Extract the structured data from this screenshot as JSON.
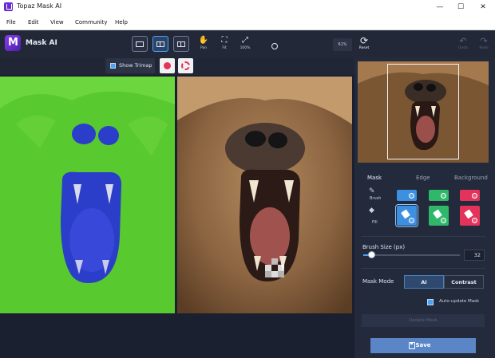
{
  "window": {
    "title": "Topaz Mask AI",
    "minimize": "—",
    "maximize": "☐",
    "close": "✕"
  },
  "menu": [
    "File",
    "Edit",
    "View",
    "Community",
    "Help"
  ],
  "toolbar": {
    "app_name": "Mask AI",
    "pan_label": "Pan",
    "fit_label": "Fit",
    "zoom100_label": "100%",
    "zoom_value": "61%",
    "reset_label": "Reset",
    "undo_label": "Undo",
    "redo_label": "Redo"
  },
  "subbar": {
    "show_trimap_label": "Show Trimap"
  },
  "panel": {
    "tabs": [
      "Mask",
      "Edge",
      "Background"
    ],
    "active_tab": "Mask",
    "brush_label": "Brush",
    "fill_label": "Fill",
    "brush_size_label": "Brush Size (px)",
    "brush_size_value": "32",
    "brush_size_fraction": 0.08,
    "mask_mode_label": "Mask Mode",
    "mask_mode_options": [
      "AI",
      "Contrast"
    ],
    "mask_mode_selected": "AI",
    "auto_update_label": "Auto-update Mask",
    "auto_update_checked": true,
    "update_button_label": "Update Mask",
    "save_label": "Save"
  },
  "colors": {
    "keep": "#3d8fe0",
    "compute": "#2fb86a",
    "cut": "#e3335b",
    "accent": "#4aa3f5",
    "mask_green": "#58c92e",
    "mask_blue": "#2b3ec9"
  }
}
